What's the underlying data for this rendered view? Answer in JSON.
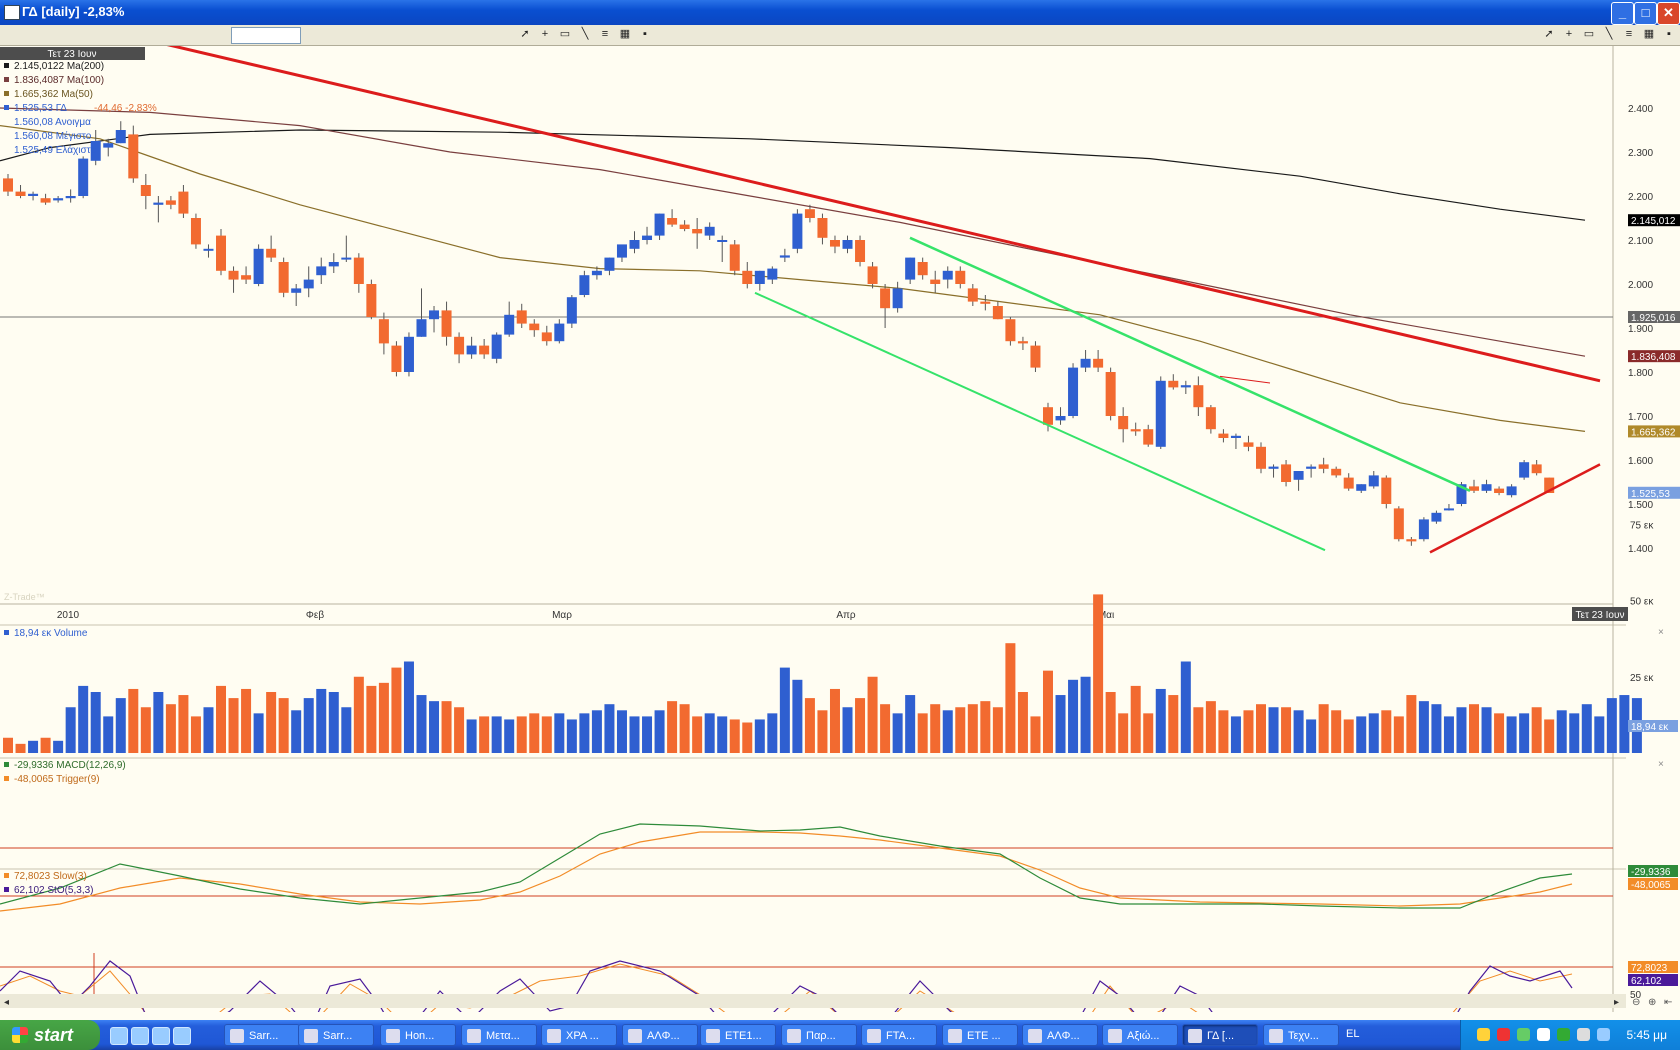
{
  "window": {
    "title": "ΓΔ [daily] -2,83%",
    "buttons": [
      "_",
      "□",
      "✕"
    ]
  },
  "toolbar": {
    "icons": [
      "pointer-icon",
      "crosshair-icon",
      "rectangle-icon",
      "line-icon",
      "menu-icon",
      "chart-icon",
      "save-icon"
    ]
  },
  "date_badge": "Τετ 23 Ιουν",
  "legend": {
    "ma200": "2.145,0122 Ma(200)",
    "ma100": "1.836,4087 Ma(100)",
    "ma50": "1.665,362 Ma(50)",
    "price": "1.525,53 ΓΔ",
    "change": "-44,46 -2,83%",
    "open": "1.560,08 Ανοιγμα",
    "high": "1.560,08 Μέγιστο",
    "low": "1.525,49 Ελάχιστο"
  },
  "watermark": "Z-Trade™",
  "price_axis": [
    "2.400",
    "2.300",
    "2.200",
    "2.100",
    "2.000",
    "1.900",
    "1.800",
    "1.700",
    "1.600",
    "1.500",
    "1.400"
  ],
  "price_tags": {
    "ma200": "2.145,012",
    "hline": "1.925,016",
    "ma100": "1.836,408",
    "ma50": "1.665,362",
    "last": "1.525,53"
  },
  "date_axis": [
    "2010",
    "Φεβ",
    "Μαρ",
    "Απρ",
    "Μαι"
  ],
  "date_axis_end": "Τετ 23 Ιουν",
  "volume": {
    "label": "18,94 εκ Volume",
    "axis": [
      "75 εκ",
      "50 εκ",
      "25 εκ"
    ],
    "tag": "18,94 εκ"
  },
  "macd": {
    "macd_label": "-29,9336 MACD(12,26,9)",
    "trigger_label": "-48,0065 Trigger(9)",
    "tag_macd": "-29,9336",
    "tag_trigger": "-48,0065"
  },
  "stoch": {
    "slow_label": "72,8023 Slow(3)",
    "sto_label": "62,102 StO(5,3,3)",
    "tag_slow": "72,8023",
    "tag_sto": "62,102",
    "axis": [
      "50"
    ]
  },
  "colors": {
    "up": "#2f5fd0",
    "down": "#f26a30",
    "ma200": "#1a1a1a",
    "ma100": "#7a3f3f",
    "ma50": "#8a6f2a",
    "trend": "#dc1c1c",
    "channel": "#36e36a",
    "macd": "#2e8b3a",
    "trigger": "#f28c28",
    "sto": "#4a1a9a"
  },
  "taskbar": {
    "start": "start",
    "tasks": [
      "Sarr...",
      "Sarr...",
      "Hon...",
      "Μετα...",
      "ΧΡΑ ...",
      "ΑΛΦ...",
      "ETE1...",
      "Παρ...",
      "FTA...",
      "ETE ...",
      "ΑΛΦ...",
      "Αξιώ...",
      "ΓΔ [...",
      "Τεχν..."
    ],
    "lang": "EL",
    "clock": "5:45 μμ"
  },
  "chart_data": {
    "type": "candlestick",
    "title": "ΓΔ [daily]",
    "ylim": [
      1380,
      2470
    ],
    "x": [
      "2010",
      "Φεβ",
      "Μαρ",
      "Απρ",
      "Μαι",
      "Τετ 23 Ιουν"
    ],
    "series": [
      {
        "name": "ΓΔ",
        "ohlc": [
          [
            2240,
            2250,
            2200,
            2210
          ],
          [
            2210,
            2225,
            2195,
            2200
          ],
          [
            2200,
            2210,
            2190,
            2205
          ],
          [
            2195,
            2205,
            2180,
            2185
          ],
          [
            2190,
            2200,
            2185,
            2195
          ],
          [
            2195,
            2215,
            2185,
            2200
          ],
          [
            2200,
            2290,
            2195,
            2285
          ],
          [
            2280,
            2350,
            2270,
            2325
          ],
          [
            2310,
            2330,
            2290,
            2320
          ],
          [
            2320,
            2370,
            2320,
            2350
          ],
          [
            2340,
            2360,
            2230,
            2240
          ],
          [
            2225,
            2250,
            2170,
            2200
          ],
          [
            2180,
            2200,
            2140,
            2185
          ],
          [
            2190,
            2200,
            2170,
            2180
          ],
          [
            2210,
            2225,
            2150,
            2160
          ],
          [
            2150,
            2160,
            2080,
            2090
          ],
          [
            2080,
            2090,
            2060,
            2080
          ],
          [
            2110,
            2125,
            2020,
            2030
          ],
          [
            2030,
            2040,
            1980,
            2010
          ],
          [
            2020,
            2040,
            2000,
            2010
          ],
          [
            2000,
            2090,
            1995,
            2080
          ],
          [
            2080,
            2110,
            2050,
            2060
          ],
          [
            2050,
            2060,
            1970,
            1980
          ],
          [
            1980,
            2000,
            1950,
            1990
          ],
          [
            1990,
            2040,
            1970,
            2010
          ],
          [
            2020,
            2060,
            2000,
            2040
          ],
          [
            2040,
            2070,
            2025,
            2050
          ],
          [
            2060,
            2110,
            2050,
            2060
          ],
          [
            2060,
            2070,
            1980,
            2000
          ],
          [
            2000,
            2010,
            1920,
            1925
          ],
          [
            1920,
            1935,
            1840,
            1865
          ],
          [
            1860,
            1870,
            1790,
            1800
          ],
          [
            1800,
            1890,
            1790,
            1880
          ],
          [
            1880,
            1990,
            1880,
            1920
          ],
          [
            1920,
            1950,
            1890,
            1940
          ],
          [
            1940,
            1960,
            1860,
            1880
          ],
          [
            1880,
            1890,
            1820,
            1840
          ],
          [
            1840,
            1880,
            1830,
            1860
          ],
          [
            1860,
            1875,
            1830,
            1840
          ],
          [
            1830,
            1890,
            1820,
            1885
          ],
          [
            1885,
            1960,
            1880,
            1930
          ],
          [
            1940,
            1955,
            1900,
            1910
          ],
          [
            1910,
            1920,
            1880,
            1895
          ],
          [
            1890,
            1905,
            1860,
            1870
          ],
          [
            1870,
            1920,
            1865,
            1910
          ],
          [
            1910,
            1975,
            1900,
            1970
          ],
          [
            1975,
            2030,
            1970,
            2020
          ],
          [
            2020,
            2040,
            2010,
            2030
          ],
          [
            2030,
            2060,
            2020,
            2060
          ],
          [
            2060,
            2080,
            2050,
            2090
          ],
          [
            2080,
            2120,
            2070,
            2100
          ],
          [
            2100,
            2130,
            2090,
            2110
          ],
          [
            2110,
            2160,
            2100,
            2160
          ],
          [
            2150,
            2170,
            2130,
            2135
          ],
          [
            2135,
            2145,
            2120,
            2125
          ],
          [
            2125,
            2150,
            2080,
            2115
          ],
          [
            2110,
            2140,
            2100,
            2130
          ],
          [
            2100,
            2110,
            2050,
            2100
          ],
          [
            2090,
            2100,
            2020,
            2030
          ],
          [
            2030,
            2050,
            1990,
            2000
          ],
          [
            2000,
            2030,
            1985,
            2030
          ],
          [
            2010,
            2040,
            2000,
            2035
          ],
          [
            2060,
            2080,
            2050,
            2065
          ],
          [
            2080,
            2170,
            2070,
            2160
          ],
          [
            2170,
            2180,
            2140,
            2150
          ],
          [
            2150,
            2160,
            2090,
            2105
          ],
          [
            2100,
            2110,
            2070,
            2085
          ],
          [
            2080,
            2110,
            2070,
            2100
          ],
          [
            2100,
            2110,
            2040,
            2050
          ],
          [
            2040,
            2050,
            1990,
            2000
          ],
          [
            1990,
            2000,
            1900,
            1945
          ],
          [
            1945,
            2005,
            1935,
            1990
          ],
          [
            2010,
            2060,
            2000,
            2060
          ],
          [
            2050,
            2060,
            2010,
            2020
          ],
          [
            2010,
            2030,
            1980,
            2000
          ],
          [
            2010,
            2040,
            1990,
            2030
          ],
          [
            2030,
            2040,
            1990,
            2000
          ],
          [
            1990,
            2000,
            1950,
            1960
          ],
          [
            1960,
            1975,
            1940,
            1955
          ],
          [
            1950,
            1960,
            1920,
            1920
          ],
          [
            1920,
            1925,
            1860,
            1870
          ],
          [
            1870,
            1880,
            1850,
            1865
          ],
          [
            1860,
            1870,
            1800,
            1810
          ],
          [
            1720,
            1730,
            1665,
            1680
          ],
          [
            1690,
            1720,
            1680,
            1700
          ],
          [
            1700,
            1820,
            1695,
            1810
          ],
          [
            1810,
            1850,
            1800,
            1830
          ],
          [
            1830,
            1850,
            1800,
            1810
          ],
          [
            1800,
            1810,
            1690,
            1700
          ],
          [
            1700,
            1720,
            1640,
            1670
          ],
          [
            1670,
            1685,
            1655,
            1665
          ],
          [
            1670,
            1680,
            1630,
            1635
          ],
          [
            1630,
            1790,
            1625,
            1780
          ],
          [
            1780,
            1795,
            1760,
            1765
          ],
          [
            1765,
            1780,
            1750,
            1770
          ],
          [
            1770,
            1790,
            1700,
            1720
          ],
          [
            1720,
            1725,
            1660,
            1670
          ],
          [
            1660,
            1670,
            1640,
            1650
          ],
          [
            1650,
            1660,
            1625,
            1655
          ],
          [
            1640,
            1655,
            1620,
            1630
          ],
          [
            1630,
            1640,
            1570,
            1580
          ],
          [
            1580,
            1590,
            1560,
            1585
          ],
          [
            1590,
            1600,
            1540,
            1550
          ],
          [
            1555,
            1570,
            1530,
            1575
          ],
          [
            1580,
            1590,
            1560,
            1585
          ],
          [
            1590,
            1605,
            1570,
            1580
          ],
          [
            1580,
            1585,
            1560,
            1565
          ],
          [
            1560,
            1570,
            1530,
            1535
          ],
          [
            1530,
            1545,
            1525,
            1545
          ],
          [
            1540,
            1575,
            1535,
            1565
          ],
          [
            1560,
            1565,
            1490,
            1500
          ],
          [
            1490,
            1495,
            1415,
            1420
          ],
          [
            1420,
            1425,
            1405,
            1415
          ],
          [
            1420,
            1470,
            1415,
            1465
          ],
          [
            1460,
            1485,
            1455,
            1480
          ],
          [
            1490,
            1500,
            1485,
            1490
          ],
          [
            1500,
            1550,
            1495,
            1545
          ],
          [
            1540,
            1555,
            1525,
            1530
          ],
          [
            1530,
            1555,
            1525,
            1545
          ],
          [
            1535,
            1540,
            1520,
            1525
          ],
          [
            1520,
            1545,
            1515,
            1540
          ],
          [
            1560,
            1600,
            1555,
            1595
          ],
          [
            1590,
            1600,
            1565,
            1570
          ],
          [
            1560,
            1560,
            1525,
            1525
          ]
        ]
      },
      {
        "name": "Ma(200)",
        "points": [
          [
            0,
            2280
          ],
          [
            20,
            2310
          ],
          [
            60,
            2340
          ],
          [
            120,
            2350
          ],
          [
            200,
            2345
          ],
          [
            300,
            2330
          ],
          [
            380,
            2310
          ],
          [
            460,
            2285
          ],
          [
            520,
            2245
          ],
          [
            560,
            2205
          ],
          [
            600,
            2170
          ],
          [
            634,
            2145
          ]
        ]
      },
      {
        "name": "Ma(100)",
        "points": [
          [
            0,
            2400
          ],
          [
            60,
            2390
          ],
          [
            120,
            2360
          ],
          [
            180,
            2300
          ],
          [
            240,
            2260
          ],
          [
            300,
            2200
          ],
          [
            360,
            2140
          ],
          [
            420,
            2070
          ],
          [
            480,
            2000
          ],
          [
            540,
            1930
          ],
          [
            600,
            1870
          ],
          [
            634,
            1836
          ]
        ]
      },
      {
        "name": "Ma(50)",
        "points": [
          [
            0,
            2360
          ],
          [
            40,
            2330
          ],
          [
            80,
            2250
          ],
          [
            120,
            2180
          ],
          [
            160,
            2120
          ],
          [
            200,
            2060
          ],
          [
            240,
            2035
          ],
          [
            280,
            2030
          ],
          [
            320,
            2010
          ],
          [
            360,
            1990
          ],
          [
            400,
            1960
          ],
          [
            440,
            1930
          ],
          [
            480,
            1870
          ],
          [
            520,
            1800
          ],
          [
            560,
            1730
          ],
          [
            600,
            1690
          ],
          [
            634,
            1665
          ]
        ]
      }
    ],
    "trendlines": [
      {
        "from": [
          55,
          2560
        ],
        "to": [
          640,
          1780
        ]
      },
      {
        "from": [
          572,
          1390
        ],
        "to": [
          640,
          1590
        ]
      },
      {
        "from": [
          364,
          2105
        ],
        "to": [
          588,
          1530
        ]
      },
      {
        "from": [
          302,
          1980
        ],
        "to": [
          530,
          1395
        ]
      },
      {
        "from": [
          488,
          1790
        ],
        "to": [
          508,
          1775
        ]
      }
    ],
    "hline": 1925,
    "volume": [
      5,
      3,
      4,
      5,
      4,
      15,
      22,
      20,
      12,
      18,
      21,
      15,
      20,
      16,
      19,
      12,
      15,
      22,
      18,
      21,
      13,
      20,
      18,
      14,
      18,
      21,
      20,
      15,
      25,
      22,
      23,
      28,
      30,
      19,
      17,
      17,
      15,
      11,
      12,
      12,
      11,
      12,
      13,
      12,
      13,
      11,
      13,
      14,
      16,
      14,
      12,
      12,
      14,
      17,
      16,
      12,
      13,
      12,
      11,
      10,
      11,
      13,
      28,
      24,
      18,
      14,
      21,
      15,
      18,
      25,
      16,
      13,
      19,
      13,
      16,
      14,
      15,
      16,
      17,
      15,
      36,
      20,
      12,
      27,
      19,
      24,
      25,
      52,
      20,
      13,
      22,
      13,
      21,
      19,
      30,
      15,
      17,
      14,
      12,
      14,
      16,
      15,
      15,
      14,
      11,
      16,
      14,
      11,
      12,
      13,
      14,
      12,
      19,
      17,
      16,
      12,
      15,
      16,
      15,
      13,
      12,
      13,
      15,
      11,
      14,
      13,
      16,
      12,
      18,
      19,
      18
    ]
  }
}
